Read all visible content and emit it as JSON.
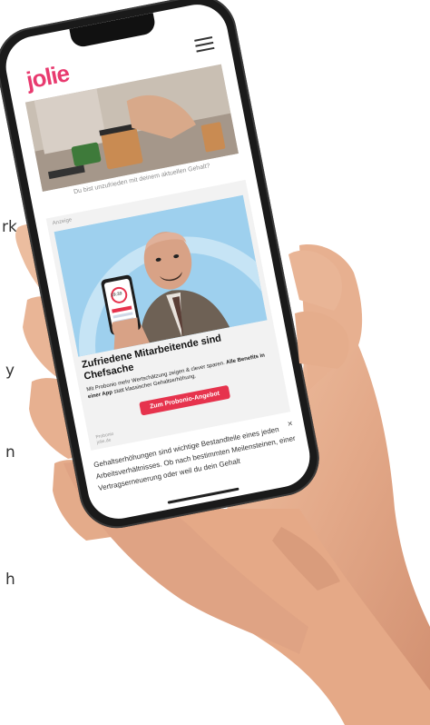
{
  "background_text": [
    "rk",
    "y",
    "n",
    "h"
  ],
  "app": {
    "logo": "jolie"
  },
  "hero_caption": "Du bist unzufrieden mit deinem aktuellen Gehalt?",
  "ad": {
    "tag": "Anzeige",
    "phone_screen_text": "19:39",
    "title": "Zufriedene Mitarbeitende sind Chefsache",
    "text_pre": "Mit Probonio mehr Wertschätzung zeigen & clever sparen. ",
    "text_bold": "Alle Benefits in einer App",
    "text_post": " statt klassischer Gehaltserhöhung.",
    "cta": "Zum Probonio-Angebot",
    "footer_line1": "Probonio",
    "footer_line2": "jolie.de"
  },
  "article_text": "Gehaltserhöhungen sind wichtige Bestandteile eines jeden Arbeitsverhältnisses. Ob nach bestimmten Meilensteinen, einer Vertragserneuerung oder weil du dein Gehalt",
  "close_label": "×",
  "colors": {
    "brand": "#e83a6f",
    "cta": "#e6334d",
    "ad_background": "#9ed0ee"
  },
  "icons": [
    "menu-icon",
    "close-icon"
  ]
}
